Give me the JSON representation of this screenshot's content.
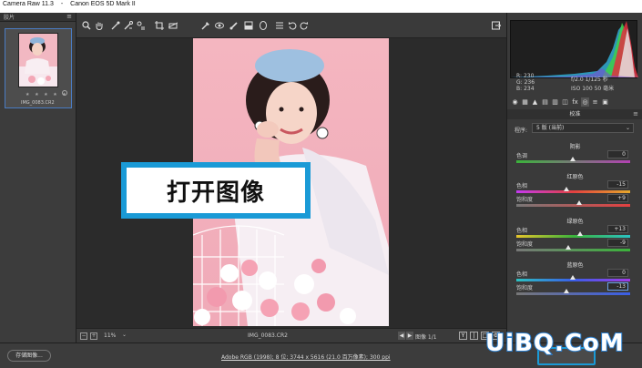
{
  "titlebar": {
    "app": "Camera Raw 11.3",
    "separator": "-",
    "camera": "Canon EOS 5D Mark II"
  },
  "filmstrip": {
    "header_label": "胶片",
    "menu_icon": "hamburger-icon",
    "thumbnail": {
      "stars": "★ ★ ★ ★ ★",
      "filename": "IMG_0083.CR2"
    }
  },
  "toolbar": {
    "tools": [
      "zoom-icon",
      "hand-icon",
      "white-balance-icon",
      "color-sampler-icon",
      "targeted-adjustment-icon",
      "crop-icon",
      "straighten-icon",
      "spot-removal-icon",
      "red-eye-icon",
      "adjustment-brush-icon",
      "graduated-filter-icon",
      "radial-filter-icon",
      "preferences-icon",
      "rotate-ccw-icon",
      "rotate-cw-icon"
    ],
    "export_icon": "export-icon"
  },
  "overlay": {
    "text": "打开图像"
  },
  "statusbar": {
    "zoom": "11%",
    "filename": "IMG_0083.CR2",
    "image_count": "图像 1/1",
    "view_buttons": [
      "Y",
      "|",
      "□"
    ]
  },
  "histogram": {
    "r_label": "R:",
    "r_value": "230",
    "g_label": "G:",
    "g_value": "236",
    "b_label": "B:",
    "b_value": "234",
    "exif_line1": "f/2.0   1/125 秒",
    "exif_line2": "ISO 100   50 毫米"
  },
  "panel": {
    "title": "校准",
    "process_label": "程序:",
    "process_value": "5 版 (当前)",
    "groups": [
      {
        "title": "阴影",
        "sliders": [
          {
            "label": "色调",
            "value": "0",
            "pos": 0.5
          }
        ]
      },
      {
        "title": "红原色",
        "sliders": [
          {
            "label": "色相",
            "value": "-15",
            "pos": 0.45
          },
          {
            "label": "饱和度",
            "value": "+9",
            "pos": 0.55
          }
        ]
      },
      {
        "title": "绿原色",
        "sliders": [
          {
            "label": "色相",
            "value": "+13",
            "pos": 0.56
          },
          {
            "label": "饱和度",
            "value": "-9",
            "pos": 0.46
          }
        ]
      },
      {
        "title": "蓝原色",
        "sliders": [
          {
            "label": "色相",
            "value": "0",
            "pos": 0.5
          },
          {
            "label": "饱和度",
            "value": "-13",
            "pos": 0.44
          }
        ]
      }
    ]
  },
  "bottombar": {
    "save_label": "存储图像...",
    "workflow_info": "Adobe RGB (1998); 8 位; 3744 x 5616 (21.0 百万像素); 300 ppi"
  },
  "watermark": "UiBQ.CoM",
  "colors": {
    "accent": "#1a9ad6",
    "panel": "#3a3a3a",
    "canvas": "#2b2b2b"
  }
}
